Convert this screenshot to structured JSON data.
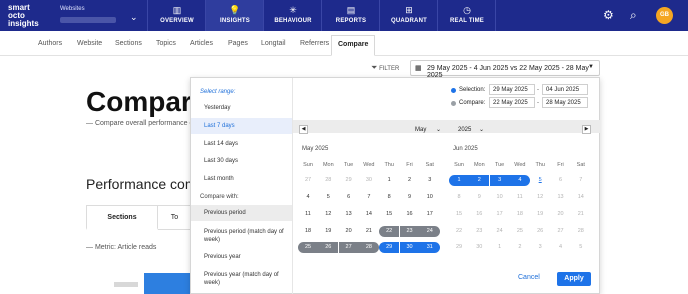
{
  "brand": {
    "logo_text": "smart octo insights"
  },
  "website_selector": {
    "label": "Websites",
    "value": ""
  },
  "nav": [
    {
      "label": "OVERVIEW",
      "icon": "bar-chart-icon",
      "glyph": "▥"
    },
    {
      "label": "INSIGHTS",
      "icon": "lightbulb-icon",
      "glyph": "💡",
      "active": true
    },
    {
      "label": "BEHAVIOUR",
      "icon": "behaviour-icon",
      "glyph": "✳"
    },
    {
      "label": "REPORTS",
      "icon": "reports-icon",
      "glyph": "▤"
    },
    {
      "label": "QUADRANT",
      "icon": "quadrant-icon",
      "glyph": "⊞"
    },
    {
      "label": "REAL TIME",
      "icon": "clock-icon",
      "glyph": "◷"
    }
  ],
  "top_icons": {
    "settings": "gear-icon",
    "search": "search-icon",
    "avatar_initials": "GB"
  },
  "subtabs": [
    "Authors",
    "Website",
    "Sections",
    "Topics",
    "Articles",
    "Pages",
    "Longtail",
    "Referrers",
    "Compare"
  ],
  "active_subtab": "Compare",
  "page": {
    "title": "Compare",
    "subtitle": "— Compare overall performance o",
    "perf_title": "Performance com",
    "tabs": [
      "Sections",
      "To"
    ],
    "metric": "— Metric: Article reads",
    "right_fragments": [
      "S",
      "2",
      "S"
    ]
  },
  "filter": {
    "label": "FILTER",
    "icon": "filter-icon"
  },
  "date_range": {
    "text": "29 May 2025 - 4 Jun 2025 vs 22 May 2025 - 28 May 2025",
    "icon": "calendar-icon"
  },
  "presets": {
    "heading": "Select range:",
    "items": [
      "Yesterday",
      "Last 7 days",
      "Last 14 days",
      "Last 30 days",
      "Last month"
    ],
    "selected": "Last 7 days",
    "compare_heading": "Compare with:",
    "compare_items": [
      "Previous period",
      "Previous period (match day of week)",
      "Previous year",
      "Previous year (match day of week)"
    ],
    "compare_selected": "Previous period"
  },
  "selection": {
    "label": "Selection:",
    "from": "29 May 2025",
    "to": "04 Jun 2025",
    "color": "#1e73e8"
  },
  "comparison": {
    "label": "Compare:",
    "from": "22 May 2025",
    "to": "28 May 2025",
    "color": "#9aa0a6"
  },
  "calendar": {
    "month_select": "May",
    "year_select": "2025",
    "weekdays": [
      "Sun",
      "Mon",
      "Tue",
      "Wed",
      "Thu",
      "Fri",
      "Sat"
    ],
    "months": [
      {
        "title": "May 2025",
        "weeks": [
          [
            {
              "d": "27",
              "m": true
            },
            {
              "d": "28",
              "m": true
            },
            {
              "d": "29",
              "m": true
            },
            {
              "d": "30",
              "m": true
            },
            {
              "d": "1"
            },
            {
              "d": "2"
            },
            {
              "d": "3"
            }
          ],
          [
            {
              "d": "4"
            },
            {
              "d": "5"
            },
            {
              "d": "6"
            },
            {
              "d": "7"
            },
            {
              "d": "8"
            },
            {
              "d": "9"
            },
            {
              "d": "10"
            }
          ],
          [
            {
              "d": "11"
            },
            {
              "d": "12"
            },
            {
              "d": "13"
            },
            {
              "d": "14"
            },
            {
              "d": "15"
            },
            {
              "d": "16"
            },
            {
              "d": "17"
            }
          ],
          [
            {
              "d": "18"
            },
            {
              "d": "19"
            },
            {
              "d": "20"
            },
            {
              "d": "21"
            },
            {
              "d": "22",
              "s": "grey"
            },
            {
              "d": "23",
              "s": "grey"
            },
            {
              "d": "24",
              "s": "grey"
            }
          ],
          [
            {
              "d": "25",
              "s": "grey"
            },
            {
              "d": "26",
              "s": "grey"
            },
            {
              "d": "27",
              "s": "grey"
            },
            {
              "d": "28",
              "s": "grey"
            },
            {
              "d": "29",
              "s": "blue"
            },
            {
              "d": "30",
              "s": "blue"
            },
            {
              "d": "31",
              "s": "blue"
            }
          ]
        ]
      },
      {
        "title": "Jun 2025",
        "weeks": [
          [
            {
              "d": "1",
              "s": "blue"
            },
            {
              "d": "2",
              "s": "blue"
            },
            {
              "d": "3",
              "s": "blue"
            },
            {
              "d": "4",
              "s": "blue"
            },
            {
              "d": "5",
              "s": "uline"
            },
            {
              "d": "6",
              "m": true
            },
            {
              "d": "7",
              "m": true
            }
          ],
          [
            {
              "d": "8",
              "m": true
            },
            {
              "d": "9",
              "m": true
            },
            {
              "d": "10",
              "m": true
            },
            {
              "d": "11",
              "m": true
            },
            {
              "d": "12",
              "m": true
            },
            {
              "d": "13",
              "m": true
            },
            {
              "d": "14",
              "m": true
            }
          ],
          [
            {
              "d": "15",
              "m": true
            },
            {
              "d": "16",
              "m": true
            },
            {
              "d": "17",
              "m": true
            },
            {
              "d": "18",
              "m": true
            },
            {
              "d": "19",
              "m": true
            },
            {
              "d": "20",
              "m": true
            },
            {
              "d": "21",
              "m": true
            }
          ],
          [
            {
              "d": "22",
              "m": true
            },
            {
              "d": "23",
              "m": true
            },
            {
              "d": "24",
              "m": true
            },
            {
              "d": "25",
              "m": true
            },
            {
              "d": "26",
              "m": true
            },
            {
              "d": "27",
              "m": true
            },
            {
              "d": "28",
              "m": true
            }
          ],
          [
            {
              "d": "29",
              "m": true
            },
            {
              "d": "30",
              "m": true
            },
            {
              "d": "1",
              "m": true
            },
            {
              "d": "2",
              "m": true
            },
            {
              "d": "3",
              "m": true
            },
            {
              "d": "4",
              "m": true
            },
            {
              "d": "5",
              "m": true
            }
          ]
        ]
      }
    ]
  },
  "actions": {
    "cancel": "Cancel",
    "apply": "Apply"
  }
}
